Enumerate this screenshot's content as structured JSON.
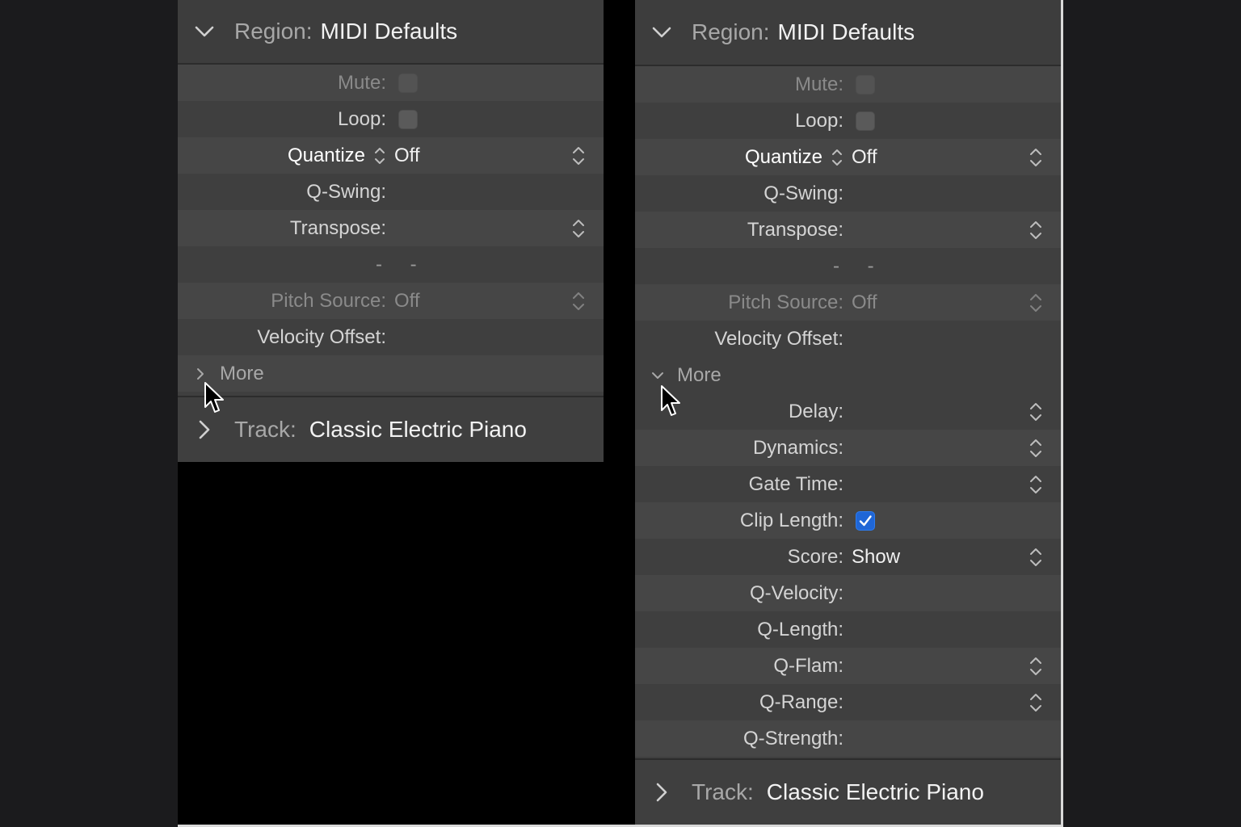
{
  "region_header": {
    "label": "Region:",
    "value": "MIDI Defaults"
  },
  "rows": {
    "mute": {
      "label": "Mute:",
      "checked": false
    },
    "loop": {
      "label": "Loop:",
      "checked": false
    },
    "quantize": {
      "label": "Quantize",
      "value": "Off"
    },
    "q_swing": {
      "label": "Q-Swing:"
    },
    "transpose": {
      "label": "Transpose:"
    },
    "dashes": "- -",
    "pitch_source": {
      "label": "Pitch Source:",
      "value": "Off"
    },
    "velocity_offset": {
      "label": "Velocity Offset:"
    }
  },
  "more": {
    "label": "More"
  },
  "more_rows": {
    "delay": {
      "label": "Delay:"
    },
    "dynamics": {
      "label": "Dynamics:"
    },
    "gate_time": {
      "label": "Gate Time:"
    },
    "clip_length": {
      "label": "Clip Length:",
      "checked": true
    },
    "score": {
      "label": "Score:",
      "value": "Show"
    },
    "q_velocity": {
      "label": "Q-Velocity:"
    },
    "q_length": {
      "label": "Q-Length:"
    },
    "q_flam": {
      "label": "Q-Flam:"
    },
    "q_range": {
      "label": "Q-Range:"
    },
    "q_strength": {
      "label": "Q-Strength:"
    }
  },
  "track_header": {
    "label": "Track:",
    "value": "Classic Electric Piano"
  },
  "colors": {
    "panel_bg": "#3f3f3f",
    "row_alt": "#464646",
    "checkbox_checked": "#1f66d6"
  },
  "icons": [
    "chevron-down-icon",
    "chevron-right-icon",
    "up-down-stepper-icon",
    "checkmark-icon",
    "mouse-pointer-icon"
  ]
}
